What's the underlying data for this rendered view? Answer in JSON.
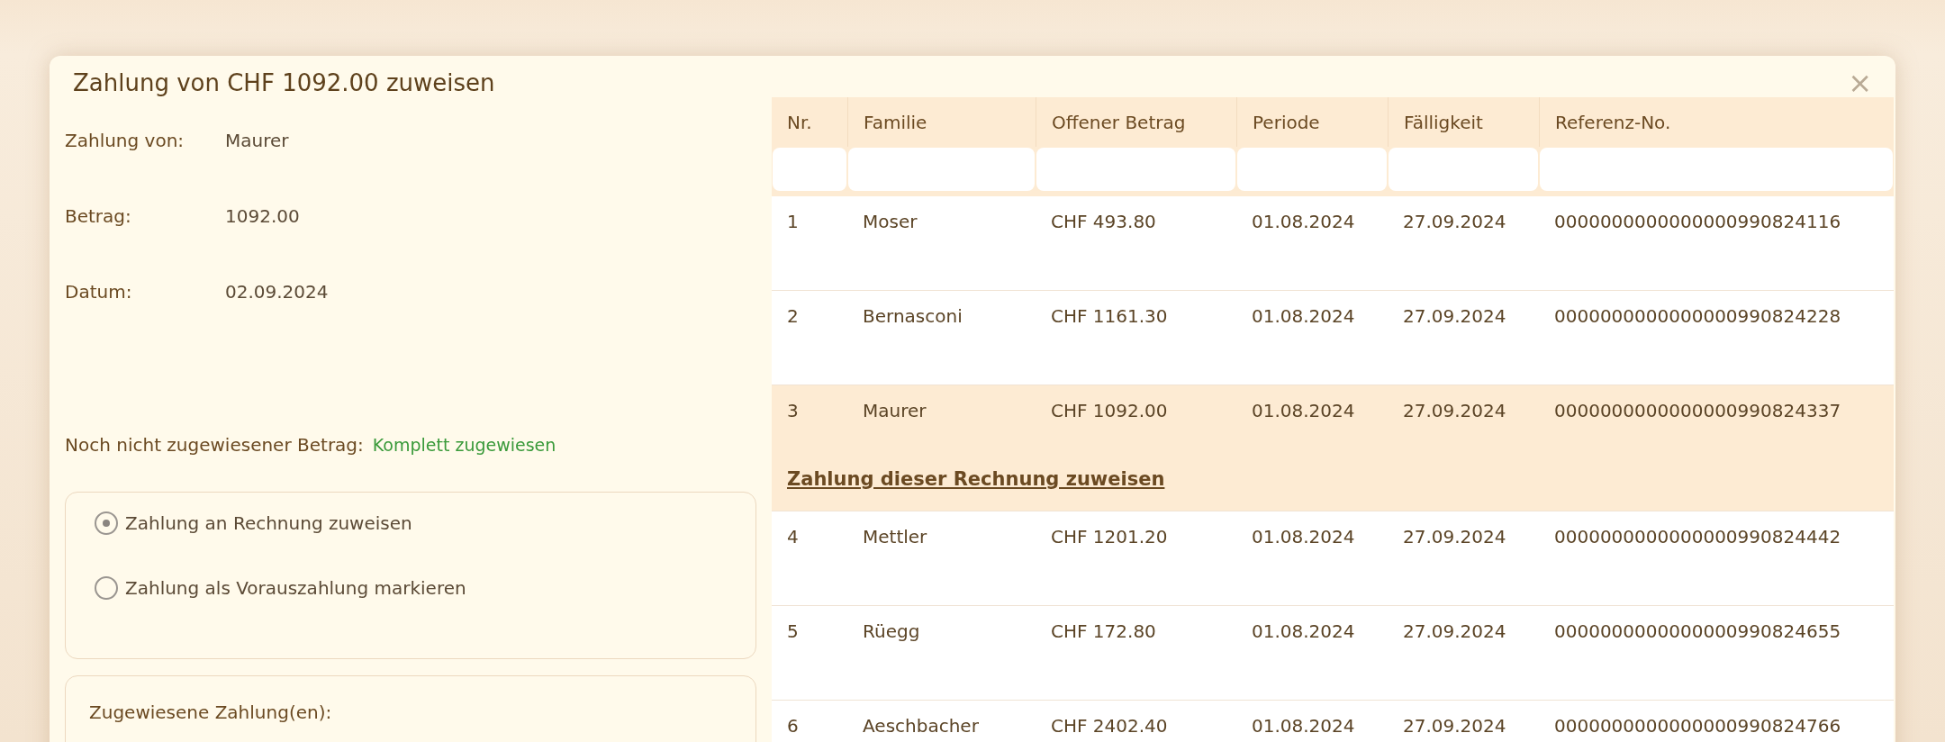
{
  "dialog": {
    "title": "Zahlung von CHF 1092.00 zuweisen",
    "close": "×"
  },
  "details": [
    {
      "label": "Zahlung von:",
      "value": "Maurer"
    },
    {
      "label": "Betrag:",
      "value": "1092.00"
    },
    {
      "label": "Datum:",
      "value": "02.09.2024"
    }
  ],
  "unassigned": {
    "label": "Noch nicht zugewiesener Betrag:",
    "value": "Komplett zugewiesen"
  },
  "options": [
    {
      "label": "Zahlung an Rechnung zuweisen",
      "selected": true
    },
    {
      "label": "Zahlung als Vorauszahlung markieren",
      "selected": false
    }
  ],
  "assigned_section": {
    "title": "Zugewiesene Zahlung(en):"
  },
  "table": {
    "columns": [
      "Nr.",
      "Familie",
      "Offener Betrag",
      "Periode",
      "Fälligkeit",
      "Referenz-No."
    ],
    "rows": [
      {
        "cells": [
          "1",
          "Moser",
          "CHF 493.80",
          "01.08.2024",
          "27.09.2024",
          "0000000000000000990824116"
        ],
        "selected": false
      },
      {
        "cells": [
          "2",
          "Bernasconi",
          "CHF 1161.30",
          "01.08.2024",
          "27.09.2024",
          "0000000000000000990824228"
        ],
        "selected": false
      },
      {
        "cells": [
          "3",
          "Maurer",
          "CHF 1092.00",
          "01.08.2024",
          "27.09.2024",
          "0000000000000000990824337"
        ],
        "selected": true,
        "action": "Zahlung dieser Rechnung zuweisen"
      },
      {
        "cells": [
          "4",
          "Mettler",
          "CHF 1201.20",
          "01.08.2024",
          "27.09.2024",
          "0000000000000000990824442"
        ],
        "selected": false
      },
      {
        "cells": [
          "5",
          "Rüegg",
          "CHF 172.80",
          "01.08.2024",
          "27.09.2024",
          "0000000000000000990824655"
        ],
        "selected": false
      },
      {
        "cells": [
          "6",
          "Aeschbacher",
          "CHF 2402.40",
          "01.08.2024",
          "27.09.2024",
          "0000000000000000990824766"
        ],
        "selected": false
      }
    ]
  }
}
